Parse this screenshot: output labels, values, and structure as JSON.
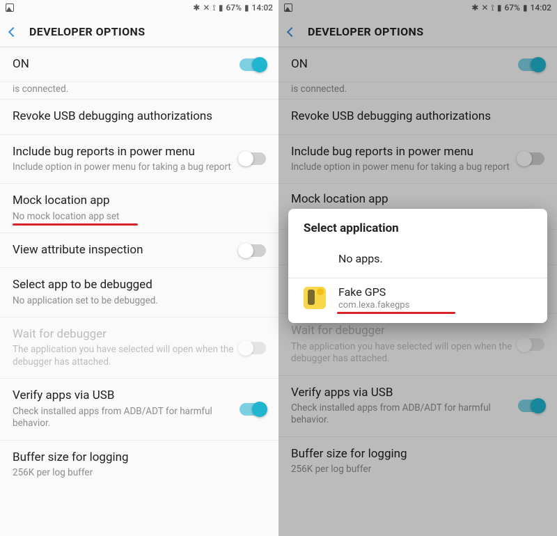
{
  "status": {
    "icons": "✱ ✕ ⋰ ⟟⟟ 67% ▮",
    "time": "14:02",
    "battery_pct": "67%"
  },
  "header": {
    "title": "DEVELOPER OPTIONS"
  },
  "rows": {
    "main_toggle": {
      "label": "ON"
    },
    "cut_sub": "is connected.",
    "revoke": {
      "title": "Revoke USB debugging authorizations"
    },
    "bugreport": {
      "title": "Include bug reports in power menu",
      "sub": "Include option in power menu for taking a bug report"
    },
    "mock": {
      "title": "Mock location app",
      "sub": "No mock location app set"
    },
    "viewattr": {
      "title": "View attribute inspection"
    },
    "selectdbg": {
      "title": "Select app to be debugged",
      "sub": "No application set to be debugged."
    },
    "waitdbg": {
      "title": "Wait for debugger",
      "sub": "The application you have selected will open when the debugger has attached."
    },
    "verify": {
      "title": "Verify apps via USB",
      "sub": "Check installed apps from ADB/ADT for harmful behavior."
    },
    "buffer": {
      "title": "Buffer size for logging",
      "sub": "256K per log buffer"
    }
  },
  "dialog": {
    "title": "Select application",
    "noapps": "No apps.",
    "app_name": "Fake GPS",
    "app_pkg": "com.lexa.fakegps"
  }
}
